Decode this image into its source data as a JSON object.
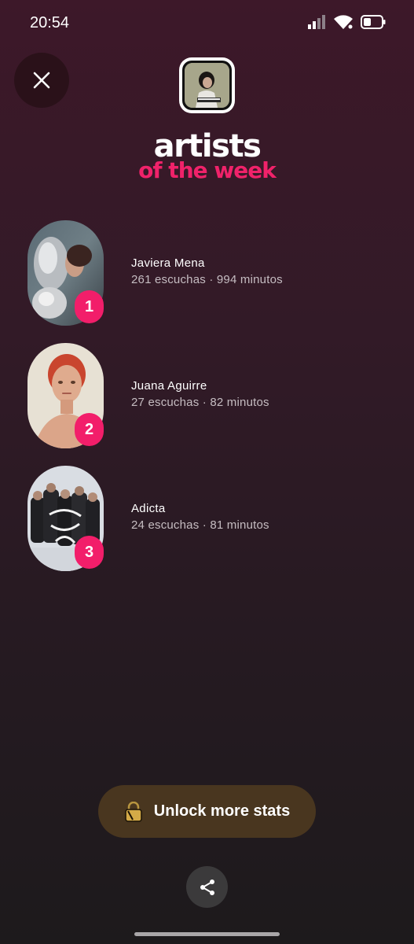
{
  "status_bar": {
    "time": "20:54"
  },
  "header": {
    "title_line1": "artists",
    "title_line2": "of the week",
    "accent_color": "#f0226a"
  },
  "artists": [
    {
      "rank": "1",
      "name": "Javiera Mena",
      "stats": "261 escuchas · 994 minutos"
    },
    {
      "rank": "2",
      "name": "Juana Aguirre",
      "stats": "27 escuchas · 82 minutos"
    },
    {
      "rank": "3",
      "name": "Adicta",
      "stats": "24 escuchas · 81 minutos"
    }
  ],
  "unlock_button": {
    "label": "Unlock more stats",
    "icon": "lock-icon"
  },
  "share_button": {
    "icon": "share-icon"
  },
  "colors": {
    "rank_badge": "#f21e6a",
    "unlock_bg": "#49361f"
  }
}
